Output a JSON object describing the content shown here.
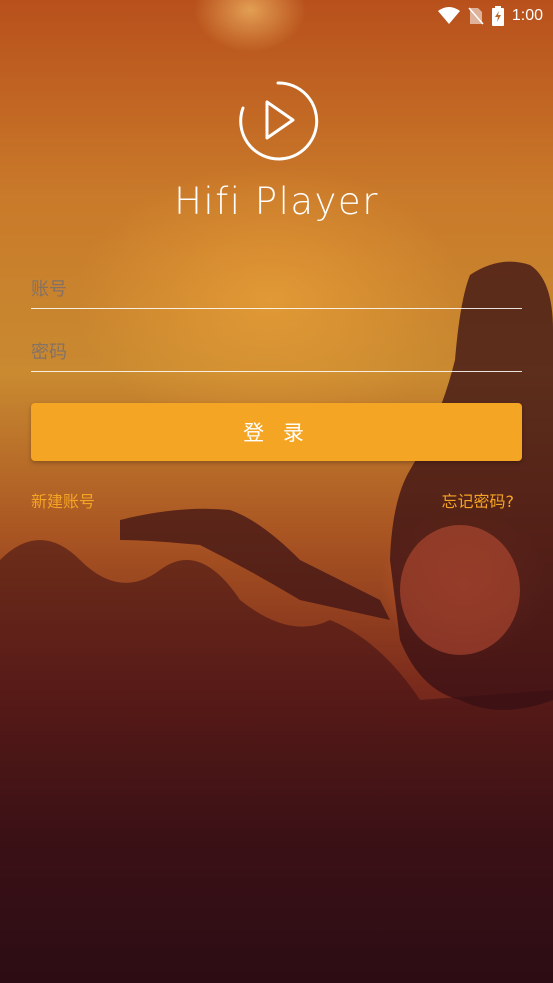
{
  "status_bar": {
    "time": "1:00",
    "icons": [
      "wifi-icon",
      "no-sim-icon",
      "battery-charging-icon"
    ]
  },
  "app": {
    "title": "Hifi Player",
    "logo_icon": "play-circle-icon"
  },
  "form": {
    "account_placeholder": "账号",
    "password_placeholder": "密码",
    "login_label": "登 录"
  },
  "links": {
    "register": "新建账号",
    "forgot_password": "忘记密码?"
  },
  "colors": {
    "accent": "#f4a524",
    "link": "#f5a424",
    "background_top": "#c97a2a",
    "background_bottom": "#1a0b16"
  }
}
